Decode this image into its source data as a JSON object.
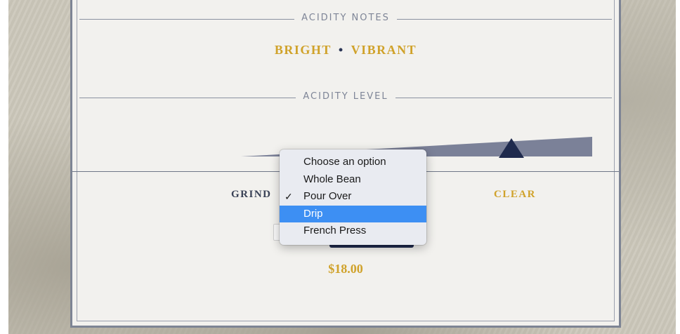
{
  "sections": {
    "acidity_notes_label": "ACIDITY NOTES",
    "acidity_level_label": "ACIDITY LEVEL"
  },
  "notes": {
    "note1": "BRIGHT",
    "separator": "•",
    "note2": "VIBRANT"
  },
  "acidity_level": {
    "value_fraction": 0.77
  },
  "grind": {
    "label": "GRIND",
    "clear_label": "CLEAR",
    "options": [
      "Choose an option",
      "Whole Bean",
      "Pour Over",
      "Drip",
      "French Press"
    ],
    "checked_option": "Pour Over",
    "highlighted_option": "Drip",
    "check_glyph": "✓"
  },
  "price": "$18.00",
  "colors": {
    "accent_gold": "#d0a22a",
    "navy": "#1f2a4d",
    "highlight_blue": "#3d8ff3",
    "slate": "#7e8597"
  }
}
